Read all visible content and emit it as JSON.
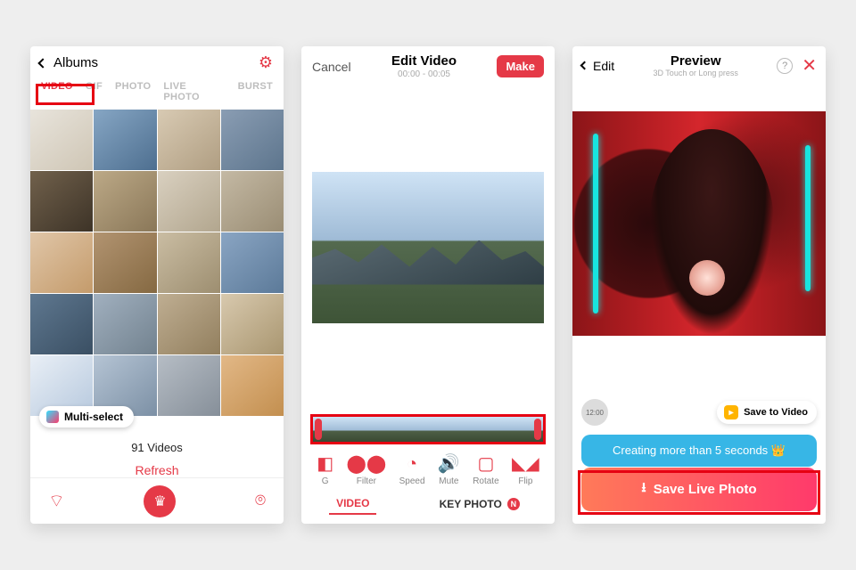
{
  "screen1": {
    "back_label": "Albums",
    "tabs": {
      "video": "VIDEO",
      "gif": "GIF",
      "photo": "PHOTO",
      "live": "LIVE PHOTO",
      "burst": "BURST"
    },
    "multiselect_label": "Multi-select",
    "count_label": "91 Videos",
    "refresh_label": "Refresh"
  },
  "screen2": {
    "cancel": "Cancel",
    "title": "Edit Video",
    "subtitle": "00:00 - 00:05",
    "make": "Make",
    "tools": {
      "bg": "G",
      "filter": "Filter",
      "speed": "Speed",
      "mute": "Mute",
      "rotate": "Rotate",
      "flip": "Flip"
    },
    "bottom_tabs": {
      "video": "VIDEO",
      "keyphoto": "KEY PHOTO",
      "badge": "N"
    }
  },
  "screen3": {
    "back": "Edit",
    "title": "Preview",
    "subtitle": "3D Touch or Long press",
    "timer": "12:00",
    "save_video": "Save to Video",
    "info": "Creating more than 5 seconds 👑",
    "save_live": "Save Live Photo"
  }
}
